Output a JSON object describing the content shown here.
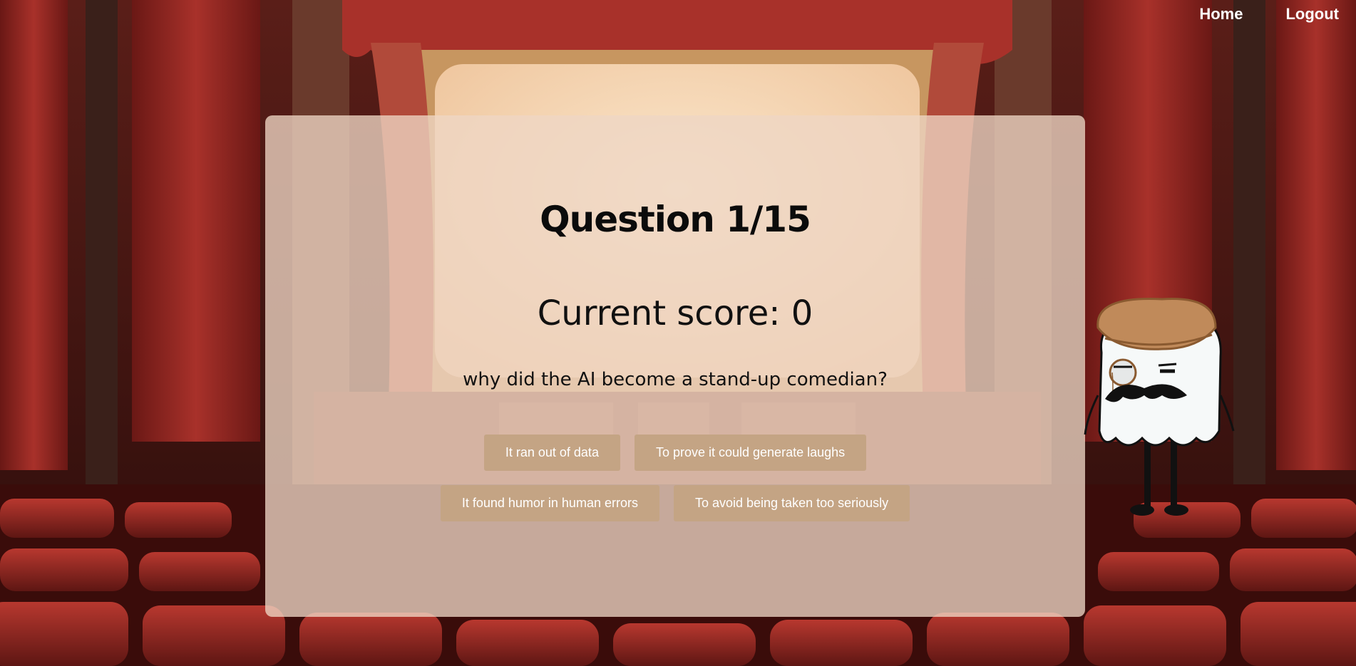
{
  "nav": {
    "home_label": "Home",
    "logout_label": "Logout"
  },
  "quiz": {
    "title": "Question 1/15",
    "score_label": "Current score: 0",
    "question": "why did the AI become a stand-up comedian?",
    "answers": [
      "It ran out of data",
      "To prove it could generate laughs",
      "It found humor in human errors",
      "To avoid being taken too seriously"
    ]
  },
  "colors": {
    "curtain_red": "#8e2420",
    "seat_red": "#9a2a25",
    "screen_cream": "#f5dcbc",
    "panel_overlay": "#eed6c4",
    "button_tan": "#c4a484",
    "mascot_hat": "#c08a5a"
  },
  "icons": {
    "mascot": "ghost-with-hat-monocle-mustache"
  }
}
